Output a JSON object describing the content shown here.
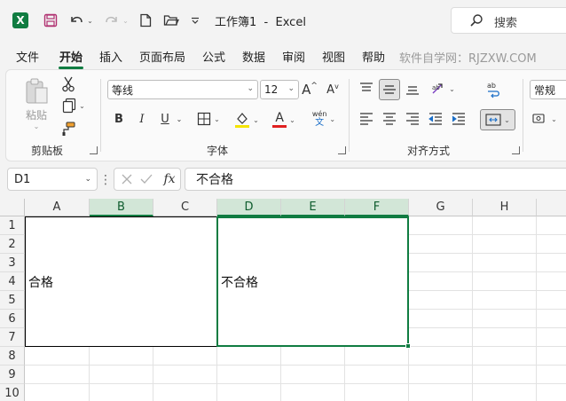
{
  "titlebar": {
    "app_logo": "X",
    "title": "工作簿1  -  Excel",
    "search_placeholder": "搜索",
    "icons": [
      "save-icon",
      "undo-icon",
      "redo-icon",
      "new-file-icon",
      "open-folder-icon",
      "customize-qat-icon",
      "search-icon"
    ]
  },
  "menu": {
    "tabs": [
      "文件",
      "开始",
      "插入",
      "页面布局",
      "公式",
      "数据",
      "审阅",
      "视图",
      "帮助"
    ],
    "active_tab": "开始",
    "watermark": "软件自学网：RJZXW.COM"
  },
  "ribbon": {
    "clipboard": {
      "label": "剪贴板",
      "paste_label": "粘贴"
    },
    "font": {
      "label": "字体",
      "font_name": "等线",
      "font_size": "12",
      "bold": "B",
      "italic": "I",
      "underline": "U",
      "grow": "A",
      "shrink": "A",
      "font_color_letter": "A",
      "wen_top": "wén",
      "wen_bottom": "文"
    },
    "alignment": {
      "label": "对齐方式"
    },
    "number": {
      "format": "常规"
    }
  },
  "formula_bar": {
    "name_box": "D1",
    "fx": "fx",
    "content": "不合格"
  },
  "sheet": {
    "columns": [
      "A",
      "B",
      "C",
      "D",
      "E",
      "F",
      "G",
      "H"
    ],
    "rows": [
      "1",
      "2",
      "3",
      "4",
      "5",
      "6",
      "7",
      "8",
      "9",
      "10"
    ],
    "selected_columns": [
      "B",
      "D",
      "E",
      "F"
    ],
    "merged_cell_a": "合格",
    "merged_cell_d": "不合格"
  },
  "colors": {
    "accent": "#107c41",
    "selected_header": "#d2e6d7",
    "font_color_bar": "#e02020",
    "highlight_bar": "#f5e400"
  }
}
